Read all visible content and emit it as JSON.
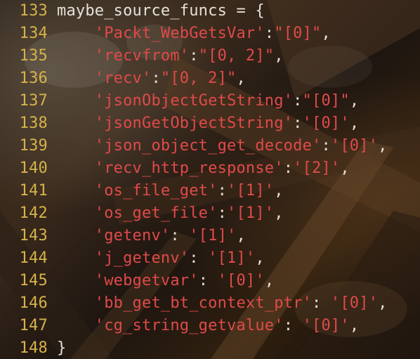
{
  "editor": {
    "lines": [
      {
        "number": "133",
        "parts": [
          {
            "t": "maybe_source_funcs = {",
            "c": "plain"
          }
        ]
      },
      {
        "number": "134",
        "parts": [
          {
            "t": "    ",
            "c": "plain"
          },
          {
            "t": "'Packt_WebGetsVar'",
            "c": "str"
          },
          {
            "t": ":",
            "c": "punct"
          },
          {
            "t": "\"[0]\"",
            "c": "str"
          },
          {
            "t": ",",
            "c": "punct"
          }
        ]
      },
      {
        "number": "135",
        "parts": [
          {
            "t": "    ",
            "c": "plain"
          },
          {
            "t": "'recvfrom'",
            "c": "str"
          },
          {
            "t": ":",
            "c": "punct"
          },
          {
            "t": "\"[0, 2]\"",
            "c": "str"
          },
          {
            "t": ",",
            "c": "punct"
          }
        ]
      },
      {
        "number": "136",
        "parts": [
          {
            "t": "    ",
            "c": "plain"
          },
          {
            "t": "'recv'",
            "c": "str"
          },
          {
            "t": ":",
            "c": "punct"
          },
          {
            "t": "\"[0, 2]\"",
            "c": "str"
          },
          {
            "t": ",",
            "c": "punct"
          }
        ]
      },
      {
        "number": "137",
        "parts": [
          {
            "t": "    ",
            "c": "plain"
          },
          {
            "t": "'jsonObjectGetString'",
            "c": "str"
          },
          {
            "t": ":",
            "c": "punct"
          },
          {
            "t": "\"[0]\"",
            "c": "str"
          },
          {
            "t": ",",
            "c": "punct"
          }
        ]
      },
      {
        "number": "138",
        "parts": [
          {
            "t": "    ",
            "c": "plain"
          },
          {
            "t": "'jsonGetObjectString'",
            "c": "str"
          },
          {
            "t": ":",
            "c": "punct"
          },
          {
            "t": "'[0]'",
            "c": "str"
          },
          {
            "t": ",",
            "c": "punct"
          }
        ]
      },
      {
        "number": "139",
        "parts": [
          {
            "t": "    ",
            "c": "plain"
          },
          {
            "t": "'json_object_get_decode'",
            "c": "str"
          },
          {
            "t": ":",
            "c": "punct"
          },
          {
            "t": "'[0]'",
            "c": "str"
          },
          {
            "t": ",",
            "c": "punct"
          }
        ]
      },
      {
        "number": "140",
        "parts": [
          {
            "t": "    ",
            "c": "plain"
          },
          {
            "t": "'recv_http_response'",
            "c": "str"
          },
          {
            "t": ":",
            "c": "punct"
          },
          {
            "t": "'[2]'",
            "c": "str"
          },
          {
            "t": ",",
            "c": "punct"
          }
        ]
      },
      {
        "number": "141",
        "parts": [
          {
            "t": "    ",
            "c": "plain"
          },
          {
            "t": "'os_file_get'",
            "c": "str"
          },
          {
            "t": ":",
            "c": "punct"
          },
          {
            "t": "'[1]'",
            "c": "str"
          },
          {
            "t": ",",
            "c": "punct"
          }
        ]
      },
      {
        "number": "142",
        "parts": [
          {
            "t": "    ",
            "c": "plain"
          },
          {
            "t": "'os_get_file'",
            "c": "str"
          },
          {
            "t": ":",
            "c": "punct"
          },
          {
            "t": "'[1]'",
            "c": "str"
          },
          {
            "t": ",",
            "c": "punct"
          }
        ]
      },
      {
        "number": "143",
        "parts": [
          {
            "t": "    ",
            "c": "plain"
          },
          {
            "t": "'getenv'",
            "c": "str"
          },
          {
            "t": ": ",
            "c": "punct"
          },
          {
            "t": "'[1]'",
            "c": "str"
          },
          {
            "t": ",",
            "c": "punct"
          }
        ]
      },
      {
        "number": "144",
        "parts": [
          {
            "t": "    ",
            "c": "plain"
          },
          {
            "t": "'j_getenv'",
            "c": "str"
          },
          {
            "t": ": ",
            "c": "punct"
          },
          {
            "t": "'[1]'",
            "c": "str"
          },
          {
            "t": ",",
            "c": "punct"
          }
        ]
      },
      {
        "number": "145",
        "parts": [
          {
            "t": "    ",
            "c": "plain"
          },
          {
            "t": "'webgetvar'",
            "c": "str"
          },
          {
            "t": ": ",
            "c": "punct"
          },
          {
            "t": "'[0]'",
            "c": "str"
          },
          {
            "t": ",",
            "c": "punct"
          }
        ]
      },
      {
        "number": "146",
        "parts": [
          {
            "t": "    ",
            "c": "plain"
          },
          {
            "t": "'bb_get_bt_context_ptr'",
            "c": "str"
          },
          {
            "t": ": ",
            "c": "punct"
          },
          {
            "t": "'[0]'",
            "c": "str"
          },
          {
            "t": ",",
            "c": "punct"
          }
        ]
      },
      {
        "number": "147",
        "parts": [
          {
            "t": "    ",
            "c": "plain"
          },
          {
            "t": "'cg_string_getvalue'",
            "c": "str"
          },
          {
            "t": ": ",
            "c": "punct"
          },
          {
            "t": "'[0]'",
            "c": "str"
          },
          {
            "t": ",",
            "c": "punct"
          }
        ]
      },
      {
        "number": "148",
        "parts": [
          {
            "t": "}",
            "c": "plain"
          }
        ]
      }
    ]
  },
  "colors": {
    "line_number": "#d6b24a",
    "identifier": "#e6e1d8",
    "string": "#e04a4a"
  }
}
